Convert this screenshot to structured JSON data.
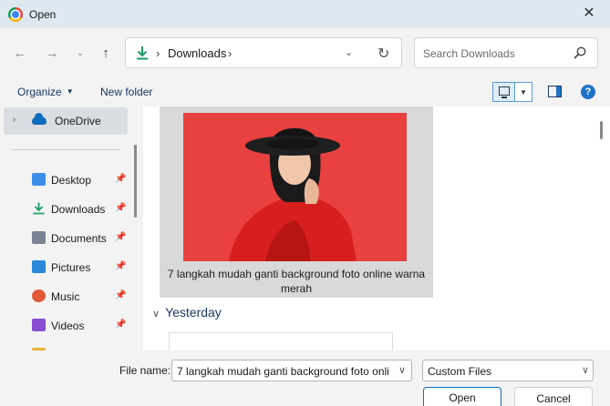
{
  "window": {
    "title": "Open",
    "close_glyph": "✕"
  },
  "nav": {
    "back_glyph": "←",
    "forward_glyph": "→",
    "recent_glyph": "⌄",
    "up_glyph": "↑",
    "address": {
      "location": "Downloads",
      "separator": "›",
      "dropdown_glyph": "⌄",
      "refresh_glyph": "↻"
    },
    "search": {
      "placeholder": "Search Downloads"
    }
  },
  "commandbar": {
    "organize_label": "Organize",
    "organize_caret": "▼",
    "new_folder_label": "New folder",
    "view_dropdown_glyph": "▼",
    "help_glyph": "?"
  },
  "sidebar": {
    "onedrive": {
      "label": "OneDrive",
      "chevron": "›",
      "icon": "cloud-icon"
    },
    "items": [
      {
        "label": "Desktop",
        "icon": "desktop-icon",
        "color": "#3a8ee6",
        "pin": "📌"
      },
      {
        "label": "Downloads",
        "icon": "download-icon",
        "color": "#1a9c64",
        "pin": "📌"
      },
      {
        "label": "Documents",
        "icon": "document-icon",
        "color": "#7a8391",
        "pin": "📌"
      },
      {
        "label": "Pictures",
        "icon": "picture-icon",
        "color": "#2b88d8",
        "pin": "📌"
      },
      {
        "label": "Music",
        "icon": "music-icon",
        "color": "#e05a3a",
        "pin": "📌"
      },
      {
        "label": "Videos",
        "icon": "video-icon",
        "color": "#8a4fd1",
        "pin": "📌"
      }
    ]
  },
  "content": {
    "selected_file": {
      "caption_line1": "7 langkah mudah ganti background foto online warna",
      "caption_line2": "merah"
    },
    "group_header": "Yesterday",
    "group_chevron": "∨"
  },
  "footer": {
    "file_name_label": "File name:",
    "file_name_value": "7 langkah mudah ganti background foto onli",
    "file_name_caret": "∨",
    "file_type_value": "Custom Files",
    "file_type_caret": "∨",
    "open_label": "Open",
    "cancel_label": "Cancel"
  },
  "colors": {
    "accent": "#0f6cbd",
    "photo_background": "#e8413f"
  }
}
